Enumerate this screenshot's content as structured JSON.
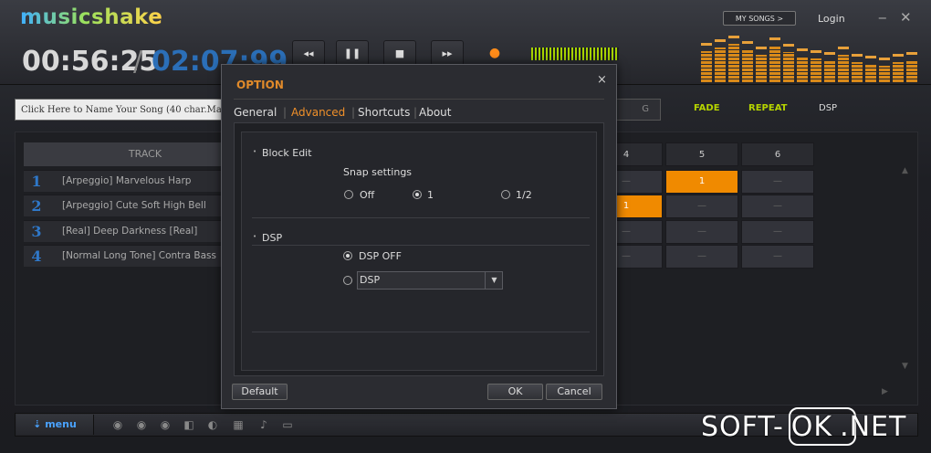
{
  "app": {
    "logo": "musicshake",
    "time_current": "00:56:25",
    "time_separator": "/",
    "time_total": "02:07:99",
    "my_songs_label": "MY SONGS >",
    "login_label": "Login",
    "minimize_icon": "minimize-icon",
    "close_icon": "close-icon"
  },
  "transport": {
    "rewind": "◂◂",
    "pause": "❚❚",
    "stop": "■",
    "forward": "▸▸",
    "record": "●"
  },
  "song_name_placeholder": "Click Here to Name Your Song (40 char.Max)",
  "toggles": {
    "fade": "FADE",
    "repeat": "REPEAT",
    "dsp": "DSP"
  },
  "colors": {
    "accent_orange": "#f08a00",
    "toggle_green": "#b6d400",
    "time_blue": "#2b6fb8"
  },
  "tracks": {
    "header": "TRACK",
    "rows": [
      {
        "num": "1",
        "name": "[Arpeggio] Marvelous Harp"
      },
      {
        "num": "2",
        "name": "[Arpeggio] Cute Soft High Bell"
      },
      {
        "num": "3",
        "name": "[Real] Deep Darkness    [Real]"
      },
      {
        "num": "4",
        "name": "[Normal Long Tone] Contra Bass"
      }
    ]
  },
  "grid": {
    "columns": [
      "4",
      "5",
      "6"
    ],
    "cells": [
      [
        "—",
        "1",
        "—"
      ],
      [
        "1",
        "—",
        "—"
      ],
      [
        "—",
        "—",
        "—"
      ],
      [
        "—",
        "—",
        "—"
      ]
    ]
  },
  "bottom": {
    "menu_label": "menu"
  },
  "dialog": {
    "title": "OPTION",
    "close": "×",
    "tabs": [
      "General",
      "Advanced",
      "Shortcuts",
      "About"
    ],
    "active_tab": "Advanced",
    "block_edit": {
      "section": "Block Edit",
      "snap_label": "Snap settings",
      "options": [
        "Off",
        "1",
        "1/2"
      ],
      "selected": "1"
    },
    "dsp": {
      "section": "DSP",
      "option_off": "DSP OFF",
      "select_value": "DSP",
      "selected": "DSP OFF"
    },
    "default_button": "Default",
    "ok_button": "OK",
    "cancel_button": "Cancel"
  },
  "watermark": {
    "prefix": "SOFT-",
    "boxed": "OK",
    "suffix": ".NET"
  }
}
